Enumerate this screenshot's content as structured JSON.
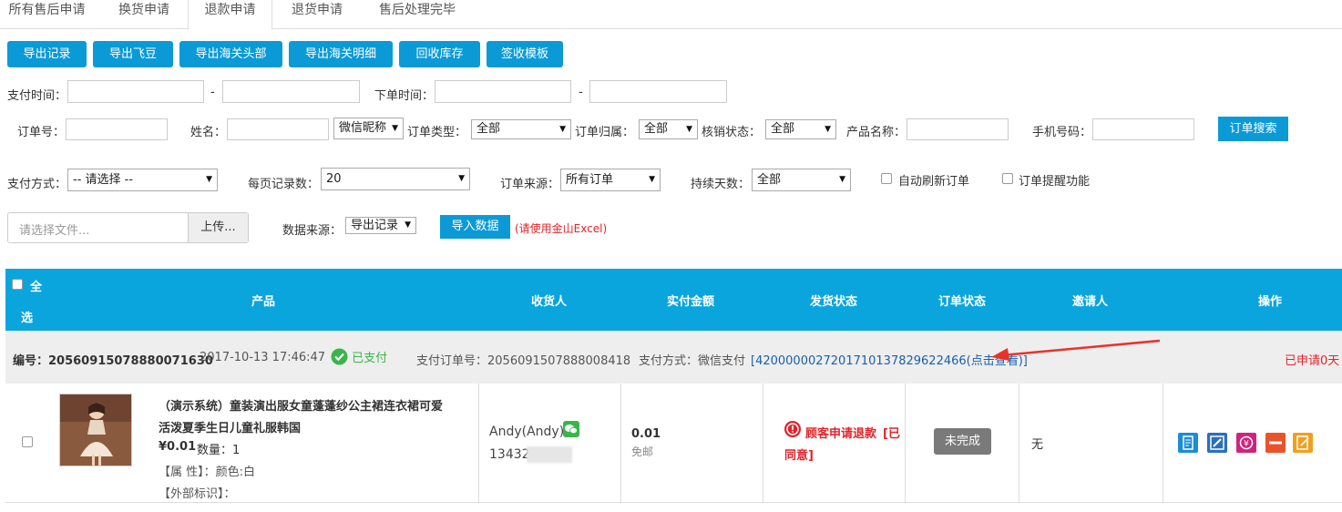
{
  "tabs": [
    "所有售后申请",
    "换货申请",
    "退款申请",
    "退货申请",
    "售后处理完毕"
  ],
  "toolbar": [
    "导出记录",
    "导出飞豆",
    "导出海关头部",
    "导出海关明细",
    "回收库存",
    "签收模板"
  ],
  "filters": {
    "pay_time_label": "支付时间：",
    "dash": "-",
    "order_time_label": "下单时间：",
    "order_no_label": "订单号：",
    "name_label": "姓名：",
    "name_type": "微信昵称",
    "order_type_label": "订单类型：",
    "order_type": "全部",
    "order_owner_label": "订单归属：",
    "order_owner": "全部",
    "verify_label": "核销状态：",
    "verify": "全部",
    "product_label": "产品名称：",
    "phone_label": "手机号码：",
    "search_btn": "订单搜索",
    "pay_method_label": "支付方式：",
    "pay_method": "-- 请选择 --",
    "page_size_label": "每页记录数：",
    "page_size": "20",
    "source_label": "订单来源：",
    "source": "所有订单",
    "days_label": "持续天数：",
    "days": "全部",
    "auto_refresh": "自动刷新订单",
    "remind": "订单提醒功能"
  },
  "upload": {
    "placeholder": "请选择文件...",
    "button": "上传...",
    "data_source_label": "数据来源：",
    "data_source": "导出记录",
    "import_btn": "导入数据",
    "note": "(请使用金山Excel)"
  },
  "table_header": {
    "select_all": "全",
    "select_all2": "选",
    "product": "产品",
    "receiver": "收货人",
    "amount": "实付金额",
    "ship_status": "发货状态",
    "order_status": "订单状态",
    "inviter": "邀请人",
    "actions": "操作"
  },
  "order": {
    "number": "编号：20560915078880071630",
    "time": "2017-10-13 17:46:47",
    "paid": "已支付",
    "pay_order_no": "支付订单号：2056091507888008418",
    "pay_method": "支付方式：微信支付",
    "transaction": "[4200000027201710137829622466(点击查看)]",
    "applied": "已申请0天",
    "product_title_1": "（演示系统）童装演出服女童蓬蓬纱公主裙连衣裙可爱",
    "product_title_2": "活泼夏季生日儿童礼服韩国",
    "price": "¥0.01",
    "qty": "数量：1",
    "attr": "【属 性】：颜色:白",
    "ext": "【外部标识】：",
    "receiver_name": "Andy(Andy)",
    "receiver_phone": "13432",
    "amount": "0.01",
    "shipping": "免邮",
    "refund_status": "顾客申请退款",
    "refund_status2": "[已",
    "refund_status3": "同意]",
    "order_status": "未完成",
    "inviter": "无"
  },
  "colors": {
    "accent": "#0b9ad6",
    "header": "#0aa5dc",
    "red": "#e0242a",
    "green": "#3ab54a"
  }
}
